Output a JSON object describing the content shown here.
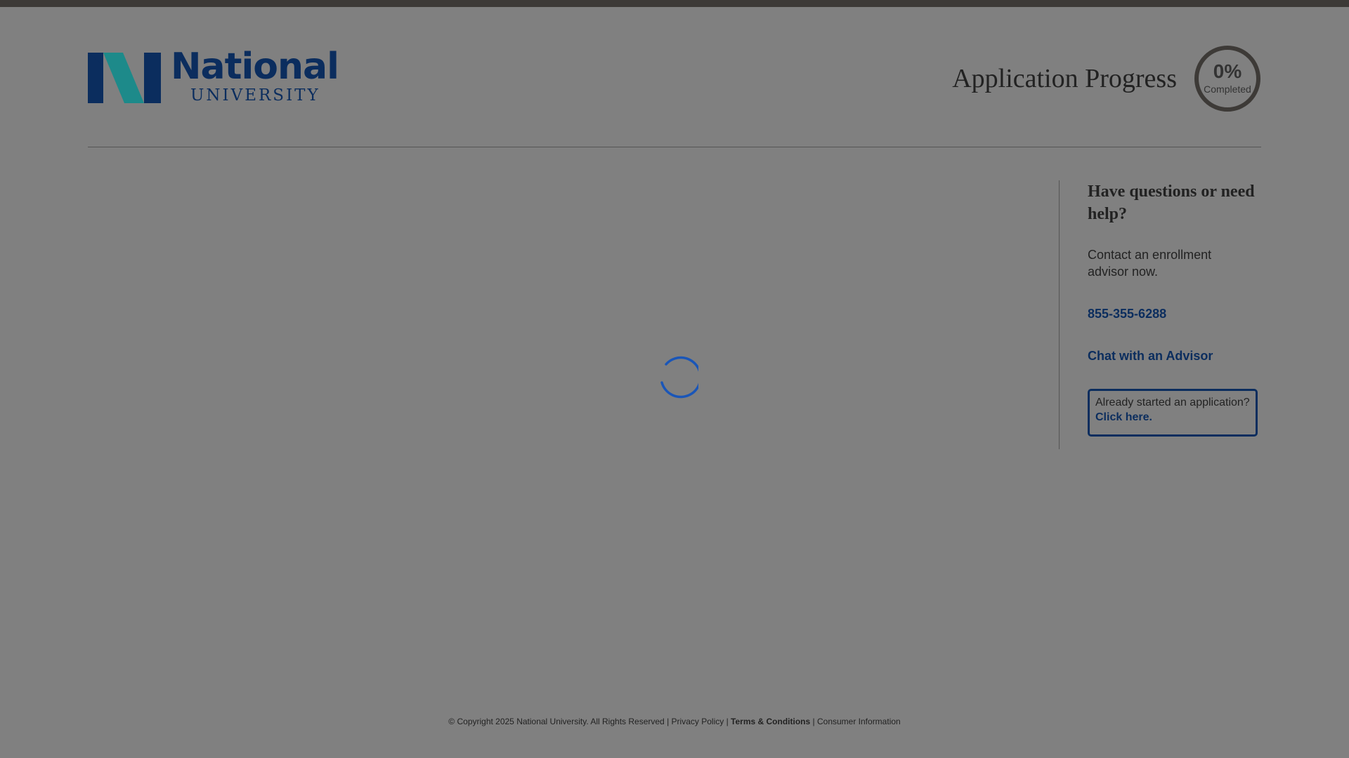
{
  "header": {
    "logo_word": "National",
    "logo_sub": "UNIVERSITY",
    "progress_title": "Application Progress",
    "progress_percent": "0%",
    "progress_label": "Completed",
    "progress_value": 0
  },
  "sidebar": {
    "heading": "Have questions or need help?",
    "contact_text": "Contact an enrollment advisor now.",
    "phone": "855-355-6288",
    "chat_link": "Chat with an Advisor",
    "resume_text": "Already started an application?",
    "resume_link": "Click here."
  },
  "footer": {
    "copyright": "© Copyright 2025 National University. All Rights Reserved",
    "sep": "|",
    "privacy": "Privacy Policy",
    "terms": "Terms & Conditions",
    "consumer": "Consumer Information"
  },
  "colors": {
    "brand_navy": "#0b2d5e",
    "brand_teal": "#1d8a8a",
    "overlay_gray": "#808080",
    "spinner_blue": "#1a56b8"
  },
  "icons": {
    "logo": "national-university-n-logo",
    "spinner": "loading-spinner-icon"
  }
}
